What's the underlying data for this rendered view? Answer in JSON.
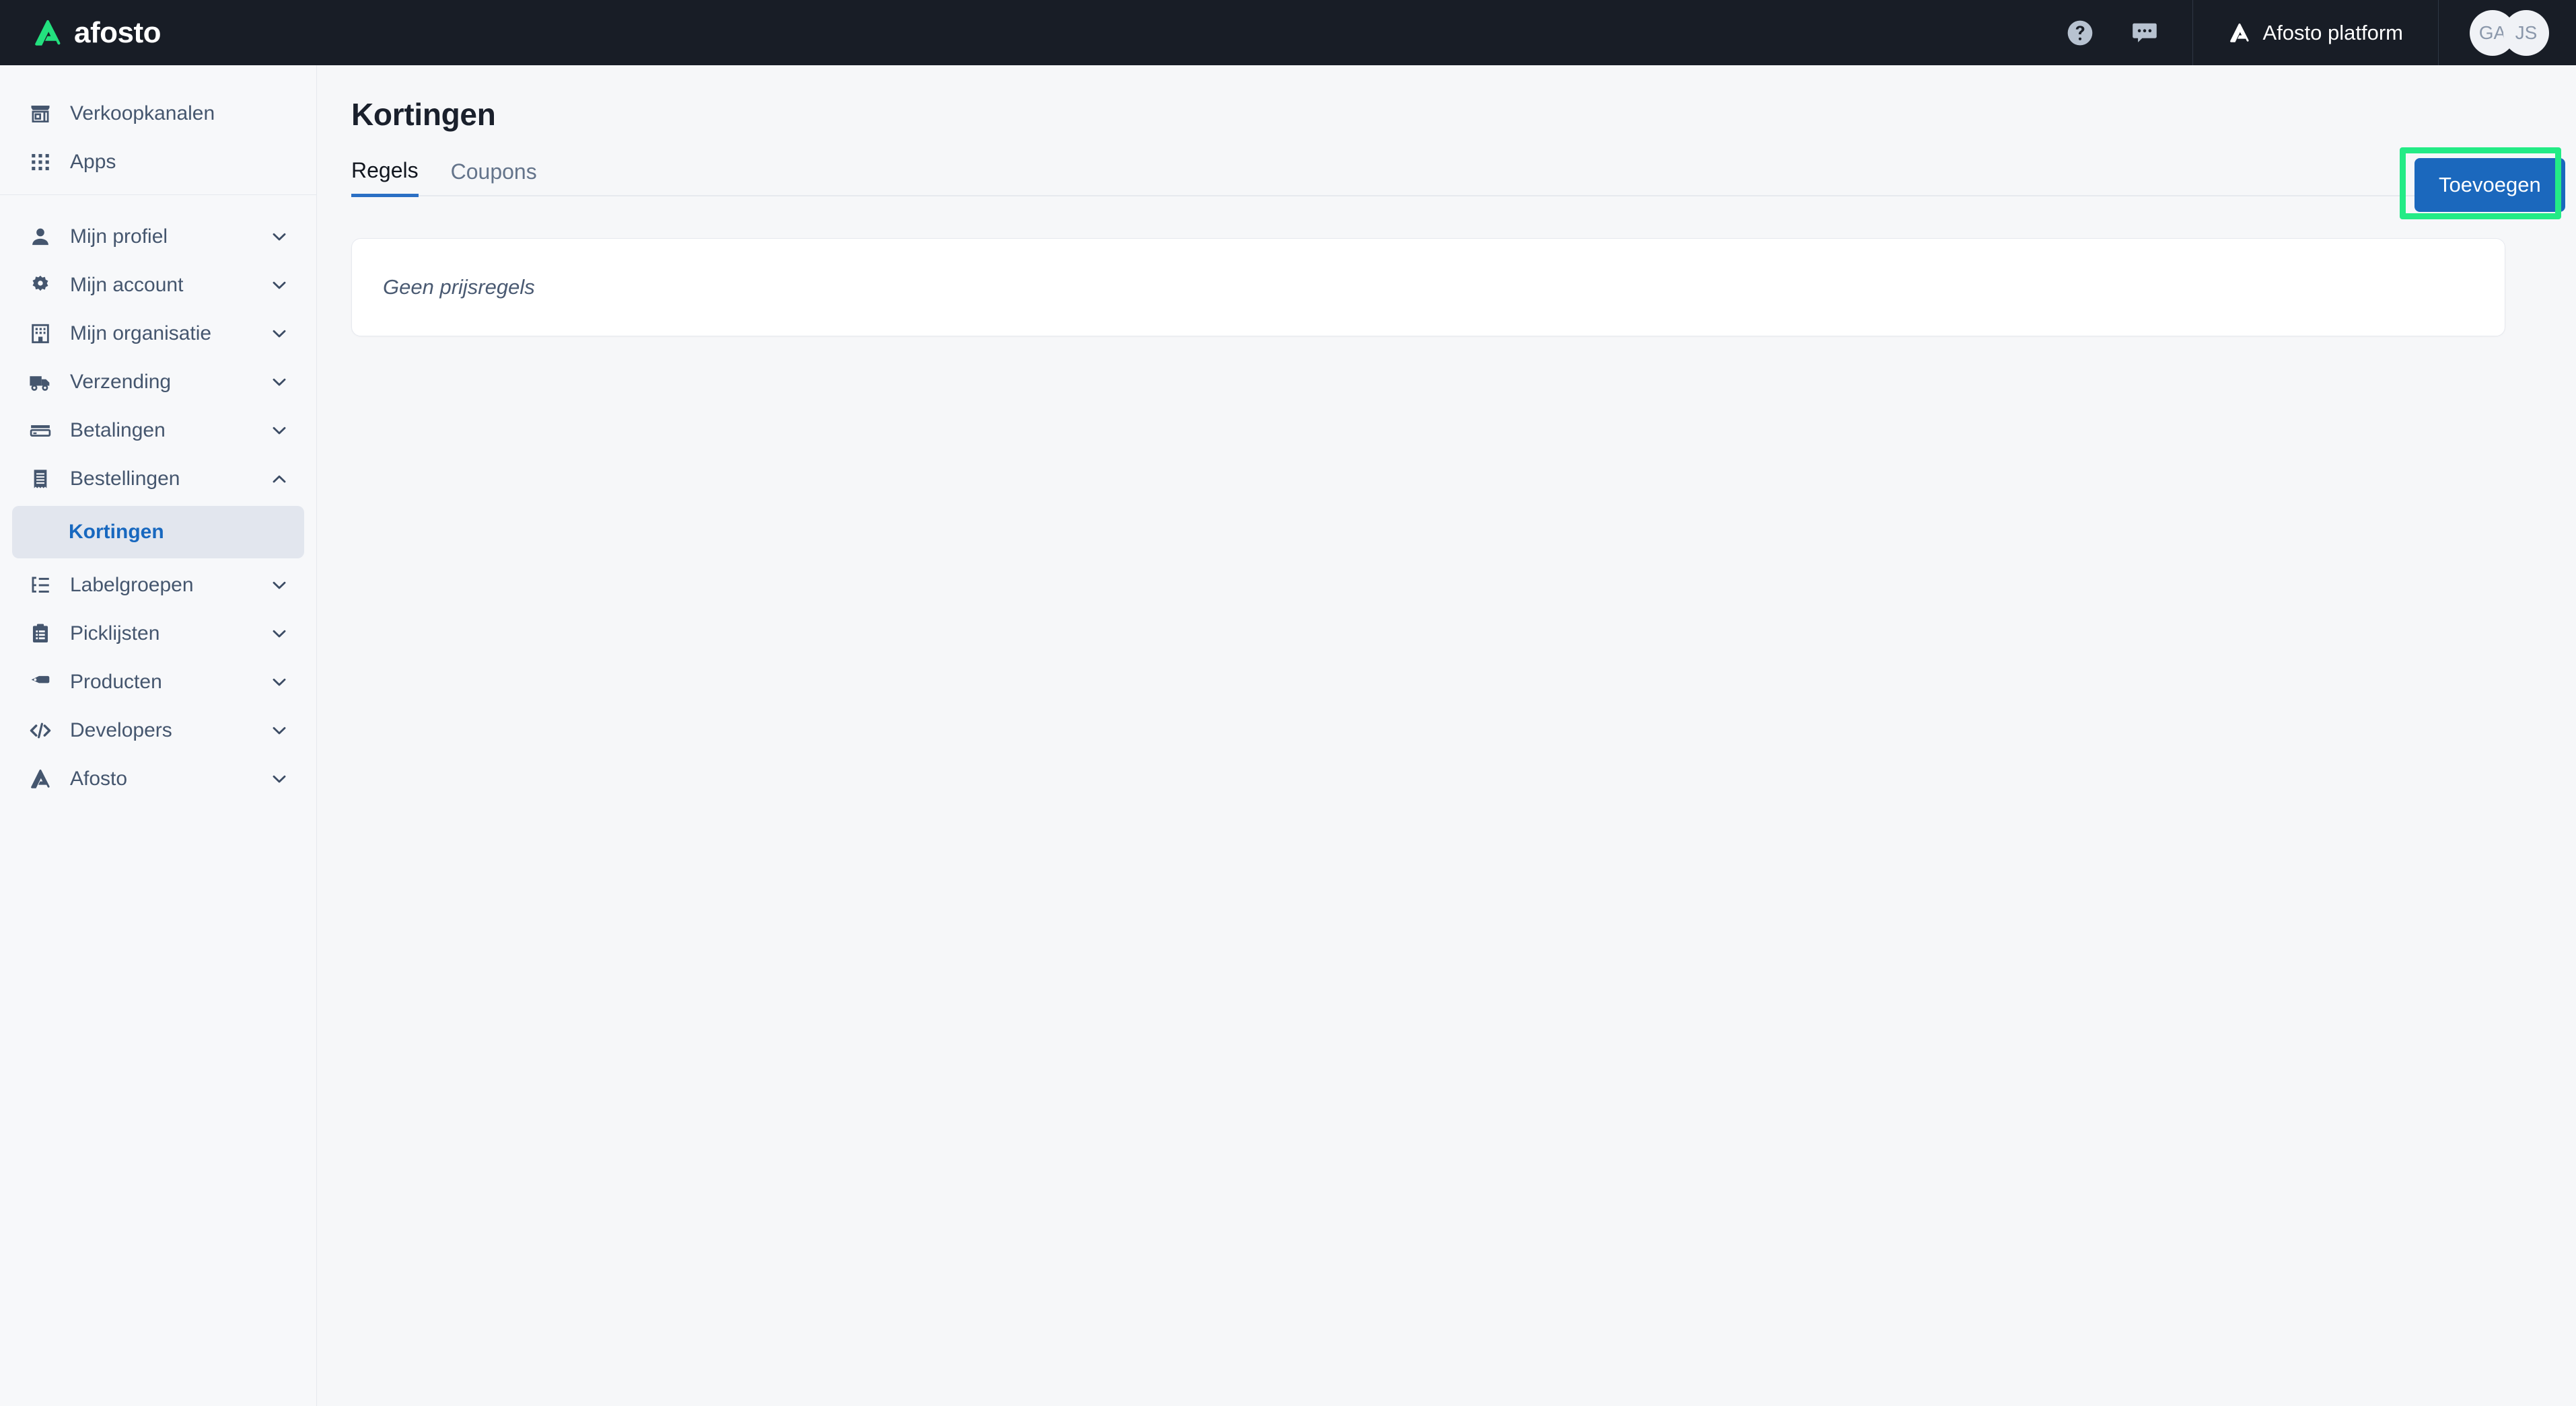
{
  "topbar": {
    "brand_name": "afosto",
    "brand_logo_icon": "afosto-triangle-logo",
    "help_icon": "help-circle-icon",
    "chat_icon": "chat-bubble-icon",
    "platform_logo_icon": "afosto-triangle-icon",
    "platform_label": "Afosto platform",
    "avatars": [
      {
        "initials": "GA"
      },
      {
        "initials": "JS"
      }
    ]
  },
  "sidebar": {
    "top_items": [
      {
        "label": "Verkoopkanalen",
        "icon": "storefront-icon",
        "expandable": false
      },
      {
        "label": "Apps",
        "icon": "grid-apps-icon",
        "expandable": false
      }
    ],
    "main_items": [
      {
        "label": "Mijn profiel",
        "icon": "user-icon",
        "expandable": true,
        "expanded": false
      },
      {
        "label": "Mijn account",
        "icon": "gear-icon",
        "expandable": true,
        "expanded": false
      },
      {
        "label": "Mijn organisatie",
        "icon": "building-icon",
        "expandable": true,
        "expanded": false
      },
      {
        "label": "Verzending",
        "icon": "truck-icon",
        "expandable": true,
        "expanded": false
      },
      {
        "label": "Betalingen",
        "icon": "credit-card-icon",
        "expandable": true,
        "expanded": false
      },
      {
        "label": "Bestellingen",
        "icon": "receipt-icon",
        "expandable": true,
        "expanded": true
      }
    ],
    "sub_item": {
      "label": "Kortingen",
      "active": true
    },
    "bottom_items": [
      {
        "label": "Labelgroepen",
        "icon": "label-list-icon",
        "expandable": true,
        "expanded": false
      },
      {
        "label": "Picklijsten",
        "icon": "clipboard-icon",
        "expandable": true,
        "expanded": false
      },
      {
        "label": "Producten",
        "icon": "tag-icon",
        "expandable": true,
        "expanded": false
      },
      {
        "label": "Developers",
        "icon": "code-icon",
        "expandable": true,
        "expanded": false
      },
      {
        "label": "Afosto",
        "icon": "afosto-triangle-icon",
        "expandable": true,
        "expanded": false
      }
    ]
  },
  "main": {
    "page_title": "Kortingen",
    "tabs": [
      {
        "label": "Regels",
        "active": true
      },
      {
        "label": "Coupons",
        "active": false
      }
    ],
    "add_button_label": "Toevoegen",
    "empty_state_text": "Geen prijsregels"
  },
  "colors": {
    "topbar_bg": "#181d26",
    "brand_green": "#23e07e",
    "accent_blue": "#1b68bd",
    "highlight_green": "#23eb86",
    "sidebar_bg": "#f7f8fa",
    "page_bg": "#f6f7f9",
    "nav_text": "#45566e",
    "active_sub_bg": "#e2e6ee"
  }
}
